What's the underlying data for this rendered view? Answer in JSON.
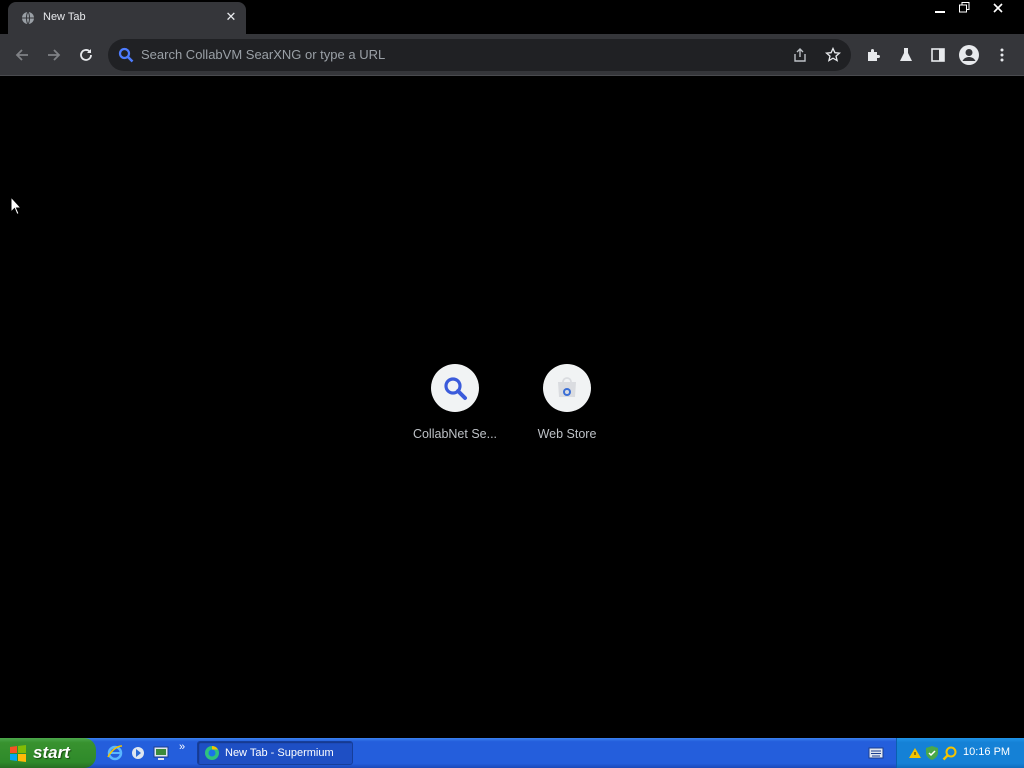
{
  "browser": {
    "tab": {
      "title": "New Tab",
      "close_glyph": "✕"
    },
    "window_controls": {
      "minimize": "—",
      "restore": "❐",
      "close": "✕"
    },
    "omnibox": {
      "placeholder": "Search CollabVM SearXNG or type a URL"
    }
  },
  "shortcuts": [
    {
      "label": "CollabNet Se...",
      "icon": "search-icon"
    },
    {
      "label": "Web Store",
      "icon": "web-store-icon"
    }
  ],
  "taskbar": {
    "start_label": "start",
    "task_item_label": "New Tab - Supermium",
    "quicklaunch_overflow": "»",
    "clock": "10:16 PM"
  },
  "colors": {
    "page_bg": "#000000",
    "toolbar_bg": "#35363a",
    "omnibox_bg": "#202124",
    "accent_blue": "#3b5bdb",
    "taskbar_blue": "#245edc",
    "start_green": "#2f8a2a"
  }
}
